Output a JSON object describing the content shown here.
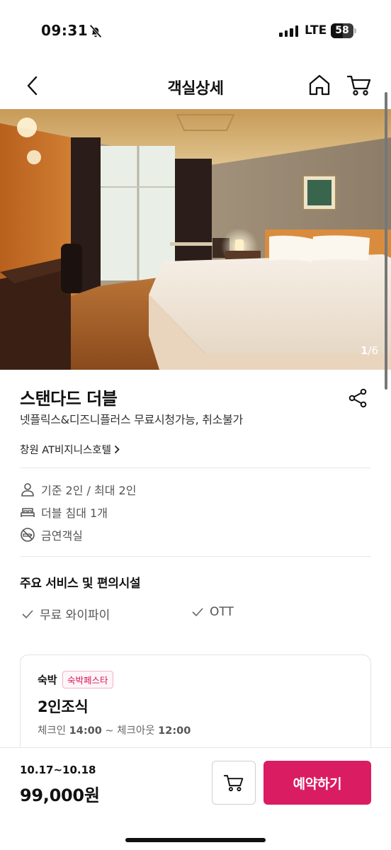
{
  "status_bar": {
    "time": "09:31",
    "network": "LTE",
    "battery": "58"
  },
  "header": {
    "title": "객실상세",
    "back_icon": "chevron-left-icon",
    "home_icon": "home-icon",
    "cart_icon": "cart-icon"
  },
  "gallery": {
    "current": "1",
    "separator": "/",
    "total": "6"
  },
  "room": {
    "name": "스탠다드 더블",
    "description": "넷플릭스&디즈니플러스 무료시청가능, 취소불가",
    "hotel": "창원 AT비지니스호텔",
    "features": [
      {
        "icon": "person-icon",
        "text": "기준 2인 / 최대 2인"
      },
      {
        "icon": "bed-icon",
        "text": "더블 침대 1개"
      },
      {
        "icon": "no-smoking-icon",
        "text": "금연객실"
      }
    ]
  },
  "amenities": {
    "title": "주요 서비스 및 편의시설",
    "items": [
      "무료 와이파이",
      "OTT"
    ]
  },
  "plan": {
    "type": "숙박",
    "badge": "숙박페스타",
    "name": "2인조식",
    "checkin_label": "체크인",
    "checkin_time": "14:00",
    "tilde": "~",
    "checkout_label": "체크아웃",
    "checkout_time": "12:00"
  },
  "booking": {
    "dates": "10.17~10.18",
    "price": "99,000원",
    "book_label": "예약하기"
  },
  "colors": {
    "accent": "#da1c63",
    "text": "#111111",
    "muted": "#555555"
  }
}
